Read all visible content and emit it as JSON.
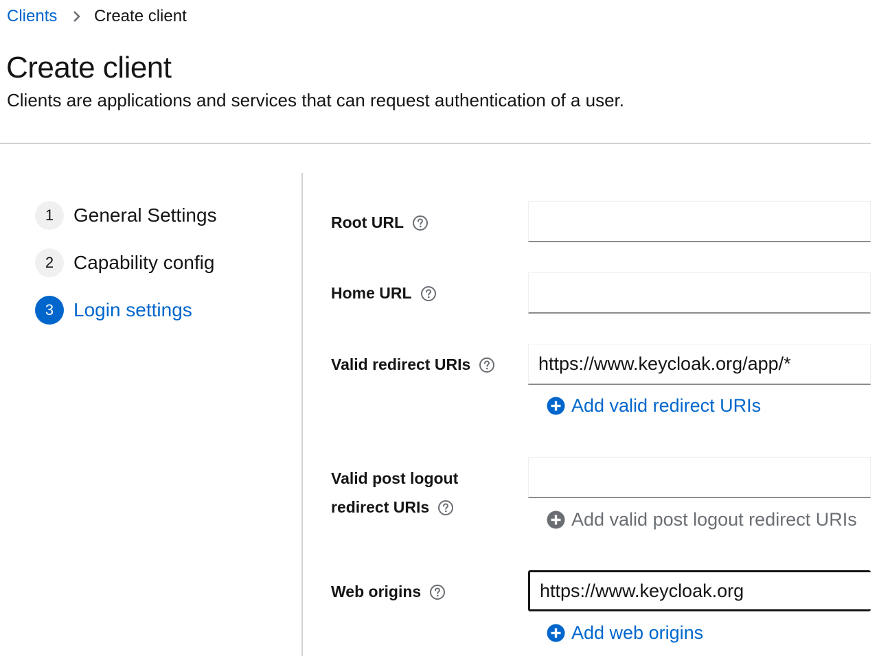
{
  "breadcrumb": {
    "parent": "Clients",
    "current": "Create client"
  },
  "header": {
    "title": "Create client",
    "description": "Clients are applications and services that can request authentication of a user."
  },
  "wizard": {
    "steps": [
      {
        "number": "1",
        "label": "General Settings",
        "state": "completed"
      },
      {
        "number": "2",
        "label": "Capability config",
        "state": "completed"
      },
      {
        "number": "3",
        "label": "Login settings",
        "state": "current"
      }
    ]
  },
  "form": {
    "root_url": {
      "label": "Root URL",
      "value": ""
    },
    "home_url": {
      "label": "Home URL",
      "value": ""
    },
    "valid_redirect_uris": {
      "label": "Valid redirect URIs",
      "value": "https://www.keycloak.org/app/*",
      "add_label": "Add valid redirect URIs"
    },
    "valid_post_logout": {
      "label_line1": "Valid post logout",
      "label_line2": "redirect URIs",
      "value": "",
      "add_label": "Add valid post logout redirect URIs"
    },
    "web_origins": {
      "label": "Web origins",
      "value": "https://www.keycloak.org",
      "add_label": "Add web origins"
    }
  },
  "colors": {
    "link": "#0066cc",
    "step_current": "#0066cc",
    "step_inactive_bg": "#f0f0f0",
    "disabled": "#6a6e73",
    "divider": "#d2d2d2"
  },
  "icons": {
    "breadcrumb_separator": "chevron-right-icon",
    "help": "question-circle-icon",
    "add": "plus-circle-icon"
  }
}
